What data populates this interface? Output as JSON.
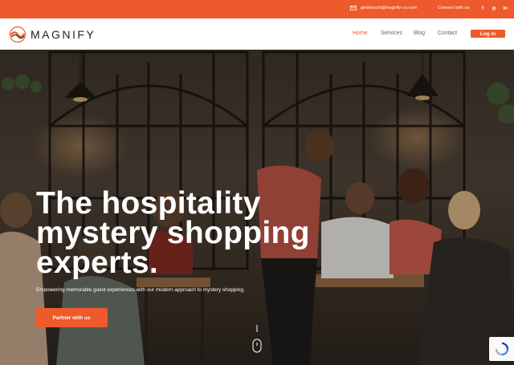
{
  "topbar": {
    "email": "getintouch@magnify-co.com",
    "connect_label": "Connect with us:",
    "socials": [
      "facebook-icon",
      "instagram-icon",
      "linkedin-icon"
    ],
    "social_glyphs": [
      "f",
      "◎",
      "in"
    ]
  },
  "header": {
    "logo_text": "MAGNIFY",
    "nav": [
      "Home",
      "Services",
      "Blog",
      "Contact"
    ],
    "active": "Home",
    "login_label": "Log in"
  },
  "hero": {
    "title": "The hospitality mystery shopping experts.",
    "subtitle": "Empowering memorable guest experiences with our modern approach to mystery shopping.",
    "cta_label": "Partner with us"
  },
  "colors": {
    "accent": "#ee5a2b",
    "text_dark": "#222222",
    "nav_text": "#666666"
  }
}
